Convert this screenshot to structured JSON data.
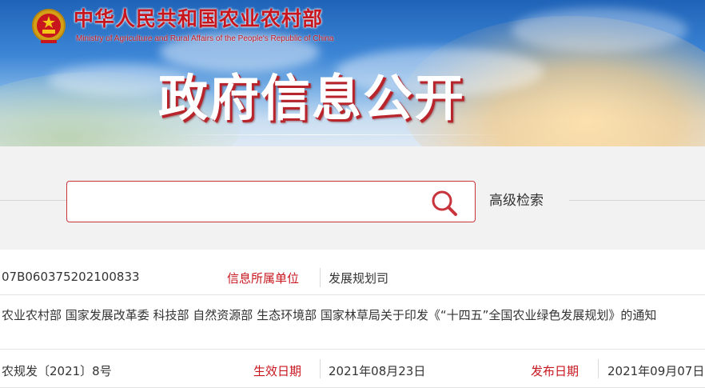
{
  "header": {
    "site_name_cn": "中华人民共和国农业农村部",
    "site_name_en": "Ministry of Agriculture and Rural Affairs of the People's Republic of China",
    "banner_title": "政府信息公开",
    "emblem_icon": "national-emblem-icon"
  },
  "search": {
    "input_value": "",
    "placeholder": "",
    "search_icon": "search-icon",
    "advanced_search_label": "高级检索"
  },
  "document": {
    "index_number": "07B060375202100833",
    "unit_label": "信息所属单位",
    "unit_value": "发展规划司",
    "title": "农业农村部 国家发展改革委 科技部 自然资源部 生态环境部 国家林草局关于印发《“十四五”全国农业绿色发展规划》的通知",
    "reference_number": "农规发〔2021〕8号",
    "effective_date_label": "生效日期",
    "effective_date_value": "2021年08月23日",
    "publish_date_label": "发布日期",
    "publish_date_value": "2021年09月07日"
  },
  "colors": {
    "accent_red": "#c8161e",
    "search_border": "#c8343b",
    "band_gray": "#f2f2f2",
    "banner_blue": "#3d86d6"
  }
}
